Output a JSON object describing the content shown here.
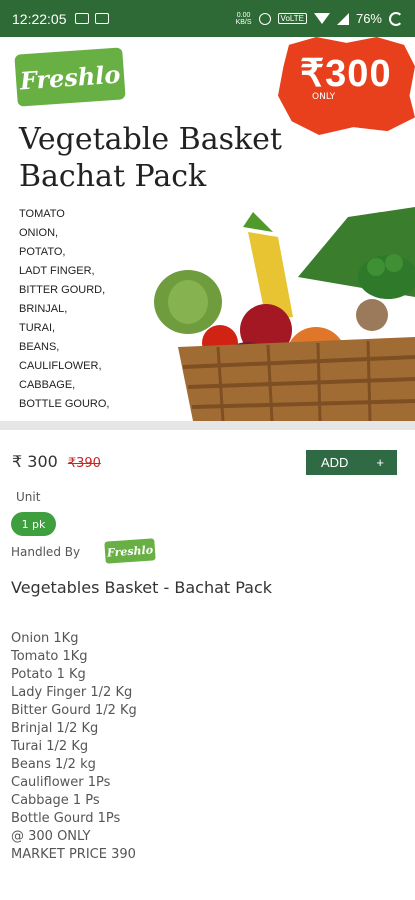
{
  "status_bar": {
    "time": "12:22:05",
    "data_speed": "0.00\nKB/S",
    "volte": "VoLTE",
    "battery": "76%"
  },
  "banner": {
    "brand": "Freshlo",
    "offer_price": "₹300",
    "offer_suffix": "ONLY",
    "title": "Vegetable Basket Bachat Pack",
    "items": [
      "TOMATO",
      "ONION,",
      "POTATO,",
      "LADT FINGER,",
      "BITTER GOURD,",
      "BRINJAL,",
      "TURAI,",
      "BEANS,",
      "CAULIFLOWER,",
      "CABBAGE,",
      "BOTTLE GOURO,"
    ]
  },
  "product": {
    "price": "₹ 300",
    "mrp": "₹390",
    "add_label": "ADD",
    "add_plus": "+",
    "unit_label": "Unit",
    "unit_value": "1 pk",
    "handled_by": "Handled By",
    "handler_logo": "Freshlo",
    "name": "Vegetables Basket - Bachat Pack",
    "description": [
      "Onion 1Kg",
      "Tomato 1Kg",
      "Potato 1 Kg",
      "Lady Finger 1/2 Kg",
      "Bitter Gourd 1/2 Kg",
      "Brinjal 1/2 Kg",
      "Turai 1/2 Kg",
      "Beans 1/2 kg",
      "Cauliflower 1Ps",
      "Cabbage 1 Ps",
      "Bottle Gourd 1Ps",
      "@ 300 ONLY",
      "MARKET PRICE 390"
    ]
  },
  "colors": {
    "status_bar": "#2e6a35",
    "brand_green": "#69b044",
    "offer_red": "#e8401c",
    "add_button": "#2f6a45",
    "unit_chip": "#3f9f3f",
    "mrp_red": "#c62828"
  },
  "icons": [
    "data-saver-icon",
    "mail-icon",
    "alarm-icon",
    "wifi-icon",
    "signal-icon",
    "battery-ring-icon",
    "vegetable-basket-image",
    "plus-icon"
  ]
}
